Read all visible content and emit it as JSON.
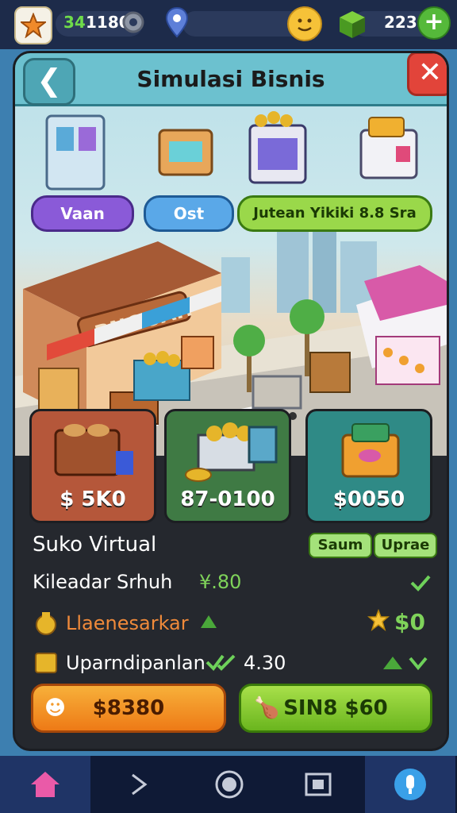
{
  "hud": {
    "resource_value": "1180",
    "resource_prefix": "34",
    "currency_value": "223"
  },
  "panel": {
    "title": "Simulasi Bisnis",
    "back_icon": "back-arrow-icon",
    "close_icon": "close-x-icon"
  },
  "scene": {
    "tag_left": "Vaan",
    "tag_middle": "Ost",
    "tag_right": "Jutean Yikiki 8.8 Sra",
    "shop_sign": "BNOUAH"
  },
  "cards": [
    {
      "value": "$ 5K0",
      "color": "#b5573a"
    },
    {
      "value": "87-0100",
      "color": "#3f7a44"
    },
    {
      "value": "$0050",
      "color": "#2f8a86"
    }
  ],
  "info": {
    "store_name": "Suko Virtual",
    "tag_a": "Saum",
    "tag_b": "Uprae",
    "row1_label": "Kileadar Srhuh",
    "row1_value": "¥.80",
    "row2_label": "Llaenesarkar",
    "row2_value": "$0",
    "row3_label": "Uparndipanlan",
    "row3_value": "4.30"
  },
  "buttons": {
    "left_label": "$8380",
    "right_label": "SIN8 $60"
  },
  "nav": {
    "items": [
      "home-icon",
      "play-icon",
      "record-icon",
      "window-icon",
      "mic-icon"
    ]
  }
}
